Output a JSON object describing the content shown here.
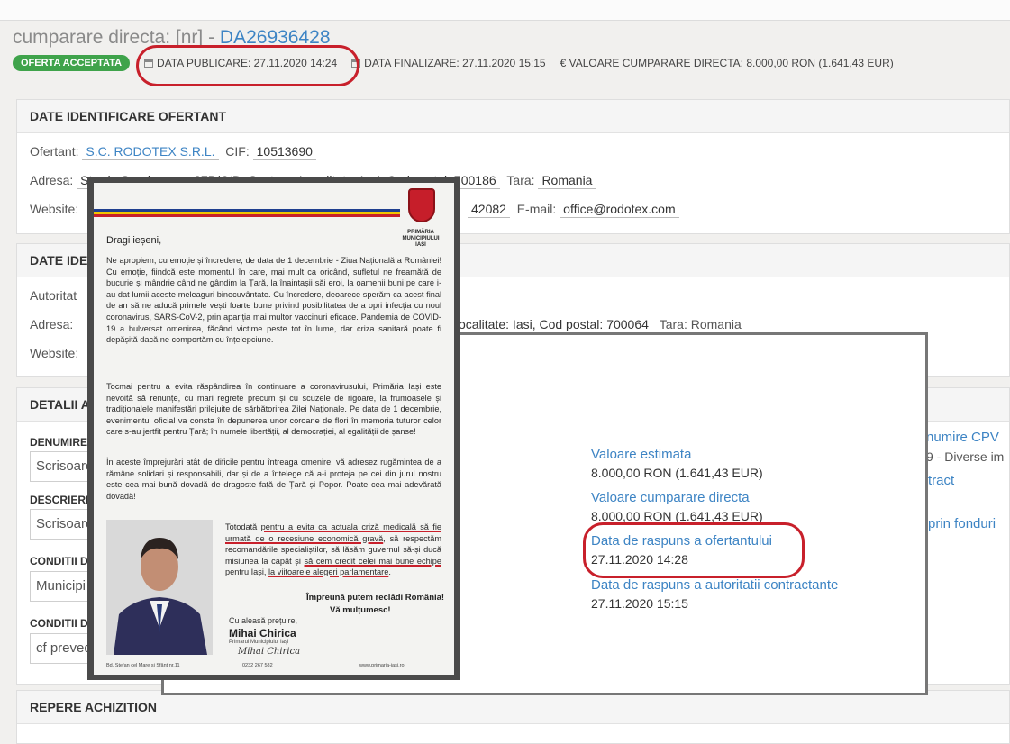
{
  "header": {
    "title_prefix": "cumparare directa: [nr] - ",
    "title_id": "DA26936428",
    "status_badge": "OFERTA ACCEPTATA",
    "data_publicare": "DATA PUBLICARE: 27.11.2020 14:24",
    "data_finalizare": "DATA FINALIZARE: 27.11.2020 15:15",
    "valoare": "€ VALOARE CUMPARARE DIRECTA: 8.000,00 RON (1.641,43 EUR)"
  },
  "ofertant": {
    "heading": "DATE IDENTIFICARE OFERTANT",
    "ofertant_label": "Ofertant:",
    "ofertant_name": "S.C. RODOTEX S.R.L.",
    "cif_label": "CIF:",
    "cif": "10513690",
    "adresa_label": "Adresa:",
    "adresa_value": "Strada Sarabana nr 27B/C/D, Sector: , Localitate: Iasi, Cod postal: 700186",
    "tara_label": "Tara:",
    "tara": "Romania",
    "website_label": "Website:",
    "phone_tail": "42082",
    "email_label": "E-mail:",
    "email": "office@rodotex.com"
  },
  "autoritate": {
    "heading": "DATE IDE",
    "autoritate_label": "Autoritat",
    "adresa_label": "Adresa:",
    "adresa_tail": "ocalitate: Iasi, Cod postal: 700064",
    "tara_label": "Tara:",
    "tara": "Romania",
    "website_label": "Website:"
  },
  "detalii": {
    "heading": "DETALII A",
    "denumire_label": "DENUMIRE",
    "denumire_value": "Scrisoare",
    "descriere_label": "DESCRIERE",
    "descriere_value": "Scrisoare",
    "conditii1_label": "CONDITII D",
    "conditii1_value": "Municipi",
    "conditii2_label": "CONDITII D",
    "conditii2_value": "cf prevede",
    "cpv_label": "numire CPV",
    "cpv_value": "9 - Diverse im",
    "contract_label": "tract",
    "fonduri_label": "prin fonduri"
  },
  "repere": {
    "heading": "REPERE ACHIZITION"
  },
  "overlay": {
    "valoare_estimata_label": "Valoare estimata",
    "valoare_estimata": "8.000,00 RON (1.641,43 EUR)",
    "valoare_cumparare_label": "Valoare cumparare directa",
    "valoare_cumparare": "8.000,00 RON (1.641,43 EUR)",
    "raspuns_ofertant_label": "Data de raspuns a ofertantului",
    "raspuns_ofertant": "27.11.2020 14:28",
    "raspuns_autoritate_label": "Data de raspuns a autoritatii contractante",
    "raspuns_autoritate": "27.11.2020 15:15"
  },
  "letter": {
    "crest_caption": "PRIMĂRIA MUNICIPIULUI IAȘI",
    "greeting": "Dragi ieșeni,",
    "p1": "Ne apropiem, cu emoție și încredere, de data de 1 decembrie - Ziua Națională a României! Cu emoție, fiindcă este momentul în care, mai mult ca oricând, sufletul ne freamătă de bucurie și mândrie când ne gândim la Țară, la înaintașii săi eroi, la oamenii buni pe care i-au dat lumii aceste meleaguri binecuvântate. Cu încredere, deoarece sperăm ca acest final de an să ne aducă primele vești foarte bune privind posibilitatea de a opri infecția cu noul coronavirus, SARS-CoV-2, prin apariția mai multor vaccinuri eficace. Pandemia de COVID-19 a bulversat omenirea, făcând victime peste tot în lume, dar criza sanitară poate fi depășită dacă ne comportăm cu înțelepciune.",
    "p2": "Tocmai pentru a evita răspândirea în continuare a coronavirusului, Primăria Iași este nevoită să renunțe, cu mari regrete precum și cu scuzele de rigoare, la frumoasele și tradiționalele manifestări prilejuite de sărbătorirea Zilei Naționale. Pe data de 1 decembrie, evenimentul oficial va consta în depunerea unor coroane de flori în memoria tuturor celor care s-au jertfit pentru Țară; în numele libertății, al democrației, al egalității de șanse!",
    "p3": "În aceste împrejurări atât de dificile pentru întreaga omenire, vă adresez rugămintea de a rămâne solidari și responsabili, dar și de a întelege că a-i proteja pe cei din jurul nostru este cea mai bună dovadă de dragoste față de Țară și Popor. Poate cea mai adevărată dovadă!",
    "p4_a": "Totodată ",
    "p4_b": "pentru a evita ca actuala criză medicală să fie urmată de o recesiune economică gravă",
    "p4_c": ", să respectăm recomandările specialiștilor, să lăsăm guvernul să-și ducă misiunea la capăt și ",
    "p4_d": "să cem credit celei mai bune echipe",
    "p4_e": " pentru Iași, ",
    "p4_f": "la viitoarele alegeri parlamentare",
    "p4_g": ".",
    "closing1": "Împreună putem reclădi România!",
    "closing2": "Vă mulțumesc!",
    "cu_pretuire": "Cu aleasă prețuire,",
    "signer": "Mihai Chirica",
    "signer_role": "Primarul Municipiului Iași",
    "signature": "Mihai Chirica",
    "footer_addr": "Bd. Ștefan cel Mare și Sfânt nr.11",
    "footer_phone": "0232 267 582",
    "footer_web": "www.primaria-iasi.ro"
  },
  "colors": {
    "accent_blue": "#3d84c4",
    "badge_green": "#3fa34b",
    "highlight_red": "#c8202b"
  }
}
